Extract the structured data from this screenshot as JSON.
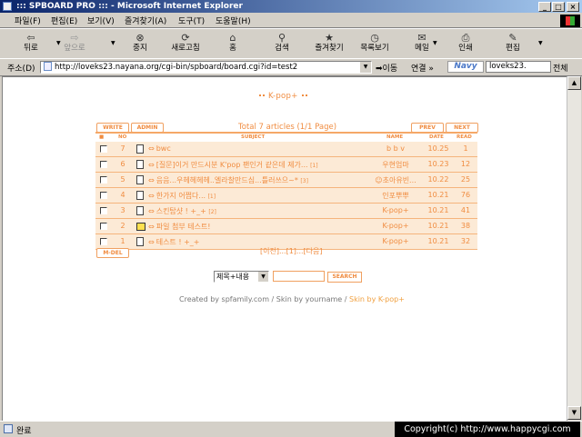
{
  "window": {
    "title": "::: SPBOARD PRO ::: - Microsoft Internet Explorer",
    "min_label": "_",
    "max_label": "□",
    "close_label": "×"
  },
  "menu": [
    "파일(F)",
    "편집(E)",
    "보기(V)",
    "즐겨찾기(A)",
    "도구(T)",
    "도움말(H)"
  ],
  "toolbar": [
    {
      "label": "뒤로",
      "icon": "back-arrow-icon",
      "glyph": "⇦"
    },
    {
      "label": "앞으로",
      "icon": "forward-arrow-icon",
      "glyph": "⇨",
      "disabled": true
    },
    {
      "label": "중지",
      "icon": "stop-icon",
      "glyph": "⊗"
    },
    {
      "label": "새로고침",
      "icon": "refresh-icon",
      "glyph": "⟳"
    },
    {
      "label": "홈",
      "icon": "home-icon",
      "glyph": "⌂"
    },
    {
      "label": "검색",
      "icon": "search-icon",
      "glyph": "⚲"
    },
    {
      "label": "즐겨찾기",
      "icon": "favorites-icon",
      "glyph": "★"
    },
    {
      "label": "목록보기",
      "icon": "history-icon",
      "glyph": "◷"
    },
    {
      "label": "메일",
      "icon": "mail-icon",
      "glyph": "✉"
    },
    {
      "label": "인쇄",
      "icon": "print-icon",
      "glyph": "⎙"
    },
    {
      "label": "편집",
      "icon": "edit-icon",
      "glyph": "✎"
    }
  ],
  "address": {
    "label": "주소(D)",
    "url": "http://loveks23.nayana.org/cgi-bin/spboard/board.cgi?id=test2",
    "go": "이동",
    "links": "연결 »",
    "navy": "Navy",
    "search_value": "loveks23.",
    "whole": "전체"
  },
  "board": {
    "title": "K-pop+",
    "write_label": "WRITE",
    "admin_label": "ADMIN",
    "prev_label": "PREV",
    "next_label": "NEXT",
    "total": "Total 7 articles (1/1 Page)",
    "columns": {
      "no": "NO",
      "subject": "SUBJECT",
      "name": "NAME",
      "date": "DATE",
      "read": "READ"
    },
    "rows": [
      {
        "no": "7",
        "subject": "bwc",
        "comment": "",
        "name": "b b v",
        "date": "10.25",
        "read": "1",
        "icon": "document-icon"
      },
      {
        "no": "6",
        "subject": "[질문]이거 만드시분 K'pop 팬인거 같은데 제가...",
        "comment": "[1]",
        "name": "우현엄마",
        "date": "10.23",
        "read": "12",
        "icon": "document-icon"
      },
      {
        "no": "5",
        "subject": "음음...우헤헤헤헤..엘라찰만드심...틀러쓰으~*",
        "comment": "[3]",
        "name": "☺초아유빈...",
        "date": "10.22",
        "read": "25",
        "icon": "document-icon"
      },
      {
        "no": "4",
        "subject": "한가지 어쩝다...",
        "comment": "[1]",
        "name": "인포뿌뿌",
        "date": "10.21",
        "read": "76",
        "icon": "document-icon"
      },
      {
        "no": "3",
        "subject": "스킨탑샷 ! +_+",
        "comment": "[2]",
        "name": "K-pop+",
        "date": "10.21",
        "read": "41",
        "icon": "document-icon"
      },
      {
        "no": "2",
        "subject": "파일 첨부 테스트!",
        "comment": "",
        "name": "K-pop+",
        "date": "10.21",
        "read": "38",
        "icon": "picture-file-icon"
      },
      {
        "no": "1",
        "subject": "테스트 ! +_+",
        "comment": "",
        "name": "K-pop+",
        "date": "10.21",
        "read": "32",
        "icon": "document-icon"
      }
    ],
    "delete_label": "M-DEL",
    "pager": "[이전]...[1]...[다음]",
    "search_select": "제목+내용",
    "search_button": "SEARCH",
    "credits_a": "Created by spfamily.com / Skin by yourname / ",
    "credits_b": "Skin by K-pop+"
  },
  "status": {
    "text": "완료",
    "copyright": "Copyright(c) http://www.happycgi.com"
  }
}
